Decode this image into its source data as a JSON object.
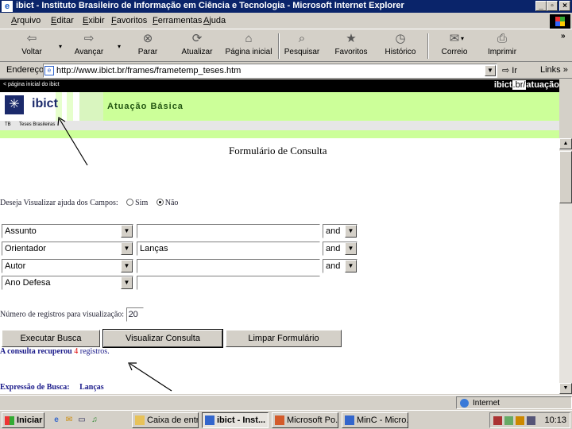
{
  "window": {
    "title": "ibict - Instituto Brasileiro de Informação em Ciência e Tecnologia - Microsoft Internet Explorer"
  },
  "menu": [
    "Arquivo",
    "Editar",
    "Exibir",
    "Favoritos",
    "Ferramentas",
    "Ajuda"
  ],
  "toolbar": {
    "back": "Voltar",
    "forward": "Avançar",
    "stop": "Parar",
    "refresh": "Atualizar",
    "home": "Página inicial",
    "search": "Pesquisar",
    "favorites": "Favoritos",
    "history": "Histórico",
    "mail": "Correio",
    "print": "Imprimir"
  },
  "address": {
    "label": "Endereço",
    "url": "http://www.ibict.br/frames/frametemp_teses.htm",
    "go": "Ir",
    "links": "Links"
  },
  "page": {
    "home_link": "< página inicial do ibict",
    "domain_main": "ibict",
    "domain_sub": ".br/",
    "domain_path": "atuação",
    "logo_text": "ibict",
    "section_title": "Atuação Básica",
    "subnav": [
      "TB",
      "Teses Brasileiras"
    ],
    "form_title": "Formulário de Consulta",
    "help_question": "Deseja Visualizar ajuda dos Campos:",
    "help_yes": "Sim",
    "help_no": "Não",
    "rows": [
      {
        "field": "Assunto",
        "value": "",
        "op": "and"
      },
      {
        "field": "Orientador",
        "value": "Lanças",
        "op": "and"
      },
      {
        "field": "Autor",
        "value": "",
        "op": "and"
      },
      {
        "field": "Ano Defesa",
        "value": ""
      }
    ],
    "records_label": "Número de registros para visualização:",
    "records_value": "20",
    "btn_execute": "Executar Busca",
    "btn_view": "Visualizar Consulta",
    "btn_clear": "Limpar Formulário",
    "result_prefix": "A consulta recuperou",
    "result_count": "4",
    "result_suffix": "registros.",
    "expr_label": "Expressão de Busca:",
    "expr_value": "Lanças"
  },
  "status": {
    "zone": "Internet"
  },
  "taskbar": {
    "start": "Iniciar",
    "tasks": [
      "Caixa de entr...",
      "ibict - Inst...",
      "Microsoft Po...",
      "MinC - Micro..."
    ],
    "clock": "10:13"
  }
}
